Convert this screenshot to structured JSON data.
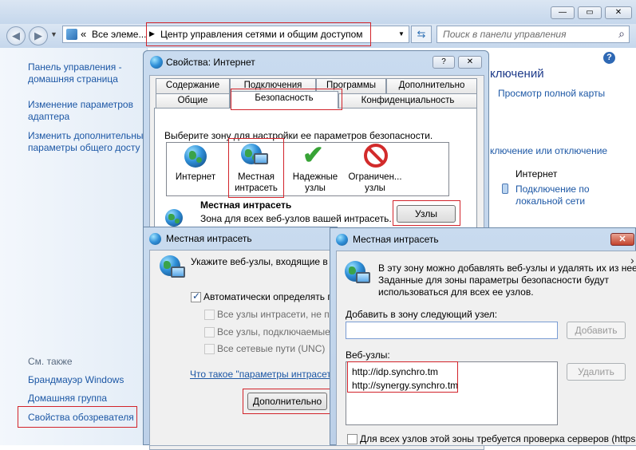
{
  "explorer": {
    "nav_back_icon": "back-arrow-icon",
    "nav_forward_icon": "forward-arrow-icon",
    "address_prefix": "«",
    "address_crumb1": "Все элеме...",
    "address_crumb2": "Центр управления сетями и общим доступом",
    "search_placeholder": "Поиск в панели управления",
    "sidebar": {
      "home_line1": "Панель управления -",
      "home_line2": "домашняя страница",
      "adapter_line1": "Изменение параметров",
      "adapter_line2": "адаптера",
      "sharing_line1": "Изменить дополнительные",
      "sharing_line2": "параметры общего досту",
      "see_also": "См. также",
      "firewall": "Брандмауэр Windows",
      "homegroup": "Домашняя группа",
      "ie_options": "Свойства обозревателя"
    },
    "main": {
      "connections_title": "ключений",
      "view_full_map": "Просмотр полной карты",
      "connect_disconnect": "ключение или отключение",
      "internet_label": "Интернет",
      "lan_line1": "Подключение по",
      "lan_line2": "локальной сети"
    }
  },
  "inet_props": {
    "title": "Свойства: Интернет",
    "help_btn": "?",
    "tabs_row1": [
      "Содержание",
      "Подключения",
      "Программы",
      "Дополнительно"
    ],
    "tabs_row2": [
      "Общие",
      "Безопасность",
      "Конфиденциальность"
    ],
    "zone_prompt": "Выберите зону для настройки ее параметров безопасности.",
    "zones": [
      {
        "line1": "Интернет",
        "line2": ""
      },
      {
        "line1": "Местная",
        "line2": "интрасеть"
      },
      {
        "line1": "Надежные",
        "line2": "узлы"
      },
      {
        "line1": "Ограничен...",
        "line2": "узлы"
      }
    ],
    "zone_heading": "Местная интрасеть",
    "zone_desc": "Зона для всех веб-узлов вашей интрасеть.",
    "sites_button": "Узлы"
  },
  "intranet1": {
    "title": "Местная интрасеть",
    "prompt": "Укажите веб-узлы, входящие в зо",
    "auto_detect": "Автоматически определять пр",
    "opt1": "Все узлы интрасети, не пер",
    "opt2": "Все узлы, подключаемые ми",
    "opt3": "Все сетевые пути (UNC)",
    "whats_link": "Что такое \"параметры интрасети\"",
    "advanced_button": "Дополнительно"
  },
  "intranet2": {
    "title": "Местная интрасеть",
    "close_icon": "close-icon",
    "info_line1": "В эту зону можно добавлять веб-узлы и удалять их из нее.",
    "info_line2": "Заданные для зоны параметры безопасности будут",
    "info_line3": "использоваться для всех ее узлов.",
    "add_label": "Добавить в зону следующий узел:",
    "add_input_value": "",
    "add_button": "Добавить",
    "sites_label": "Веб-узлы:",
    "sites": [
      "http://idp.synchro.tm",
      "http://synergy.synchro.tm"
    ],
    "remove_button": "Удалить",
    "require_https": "Для всех узлов этой зоны требуется проверка серверов (https:)"
  }
}
